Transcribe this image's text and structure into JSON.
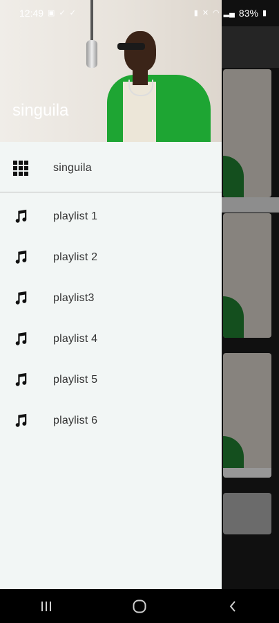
{
  "status_bar": {
    "time": "12:49",
    "battery": "83%"
  },
  "drawer": {
    "header_title": "singuila",
    "items": [
      {
        "label": "singuila",
        "icon": "apps-grid-icon"
      },
      {
        "label": "playlist 1",
        "icon": "music-note-icon"
      },
      {
        "label": "playlist 2",
        "icon": "music-note-icon"
      },
      {
        "label": "playlist3",
        "icon": "music-note-icon"
      },
      {
        "label": "playlist 4",
        "icon": "music-note-icon"
      },
      {
        "label": "playlist 5",
        "icon": "music-note-icon"
      },
      {
        "label": "playlist 6",
        "icon": "music-note-icon"
      }
    ]
  },
  "nav_bar": {
    "buttons": [
      "recents-button",
      "home-button",
      "back-button"
    ]
  },
  "colors": {
    "drawer_bg": "#f2f6f5",
    "accent_green": "#1ea533"
  }
}
